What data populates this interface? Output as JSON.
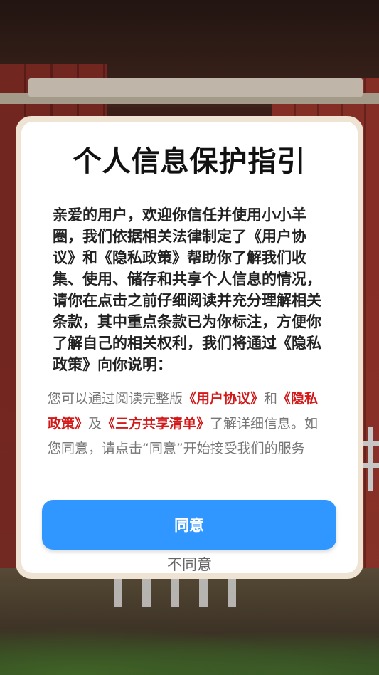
{
  "dialog": {
    "title": "个人信息保护指引",
    "body_text": "亲爱的用户，欢迎你信任并使用小小羊圈，我们依据相关法律制定了《用户协议》和《隐私政策》帮助你了解我们收集、使用、储存和共享个人信息的情况，请你在点击之前仔细阅读并充分理解相关条款，其中重点条款已为你标注，方便你了解自己的相关权利，我们将通过《隐私政策》向你说明：",
    "notice": {
      "prefix": "您可以通过阅读完整版",
      "link_user_agreement": "《用户协议》",
      "and": "和",
      "link_privacy_policy": "《隐私政策》",
      "and2": "及",
      "link_third_party_list": "《三方共享清单》",
      "suffix": "了解详细信息。如您同意，请点击“同意”开始接受我们的服务"
    },
    "agree_label": "同意",
    "disagree_label": "不同意"
  },
  "colors": {
    "primary_button": "#2f97ff",
    "link": "#d21a1a",
    "dialog_frame": "#efe4d4"
  }
}
